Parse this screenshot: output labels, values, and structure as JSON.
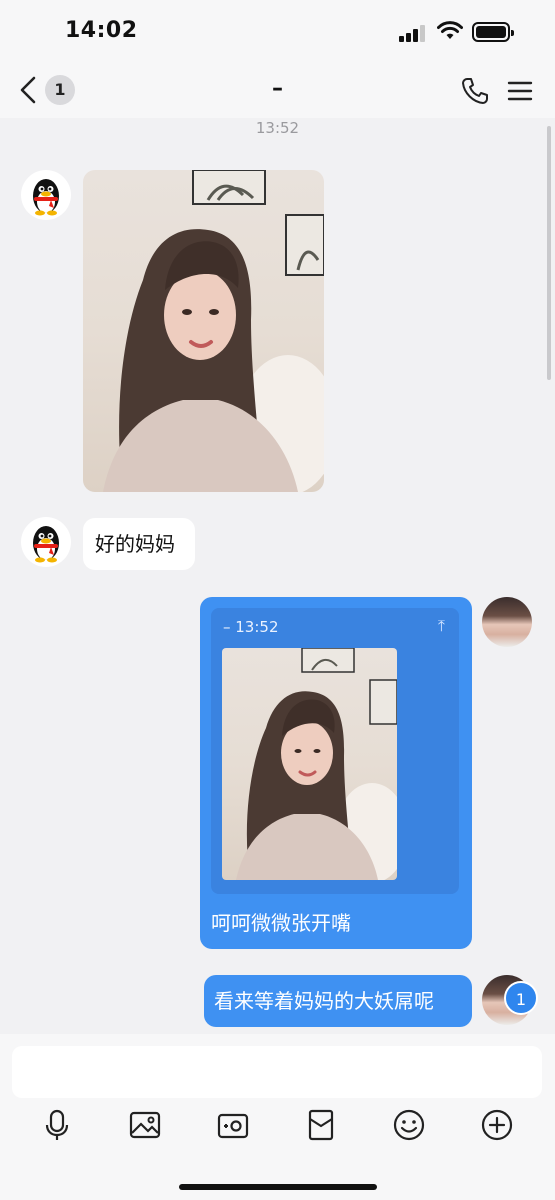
{
  "status_bar": {
    "time": "14:02",
    "icons": [
      "signal-icon",
      "wifi-icon",
      "battery-icon"
    ]
  },
  "nav": {
    "back_badge": "1",
    "title": "–",
    "icons": [
      "back-icon",
      "phone-icon",
      "menu-icon"
    ]
  },
  "chat": {
    "timestamp": "13:52",
    "messages": [
      {
        "side": "left",
        "type": "image",
        "avatar": "qq-penguin-avatar"
      },
      {
        "side": "left",
        "type": "text",
        "text": "好的妈妈",
        "avatar": "qq-penguin-avatar"
      },
      {
        "side": "right",
        "type": "reply",
        "quote_header": "– 13:52",
        "text": "呵呵微微张开嘴",
        "avatar": "user-avatar"
      },
      {
        "side": "right",
        "type": "text",
        "text": "看来等着妈妈的大妖屌呢",
        "avatar": "user-avatar",
        "badge": "1"
      }
    ]
  },
  "input": {
    "placeholder": "",
    "toolbar": [
      "microphone-icon",
      "image-icon",
      "camera-icon",
      "red-packet-icon",
      "emoji-icon",
      "plus-icon"
    ]
  },
  "colors": {
    "bubble_blue": "#3f91f2",
    "quote_blue": "#3a83e0",
    "background": "#f1f1f3"
  }
}
